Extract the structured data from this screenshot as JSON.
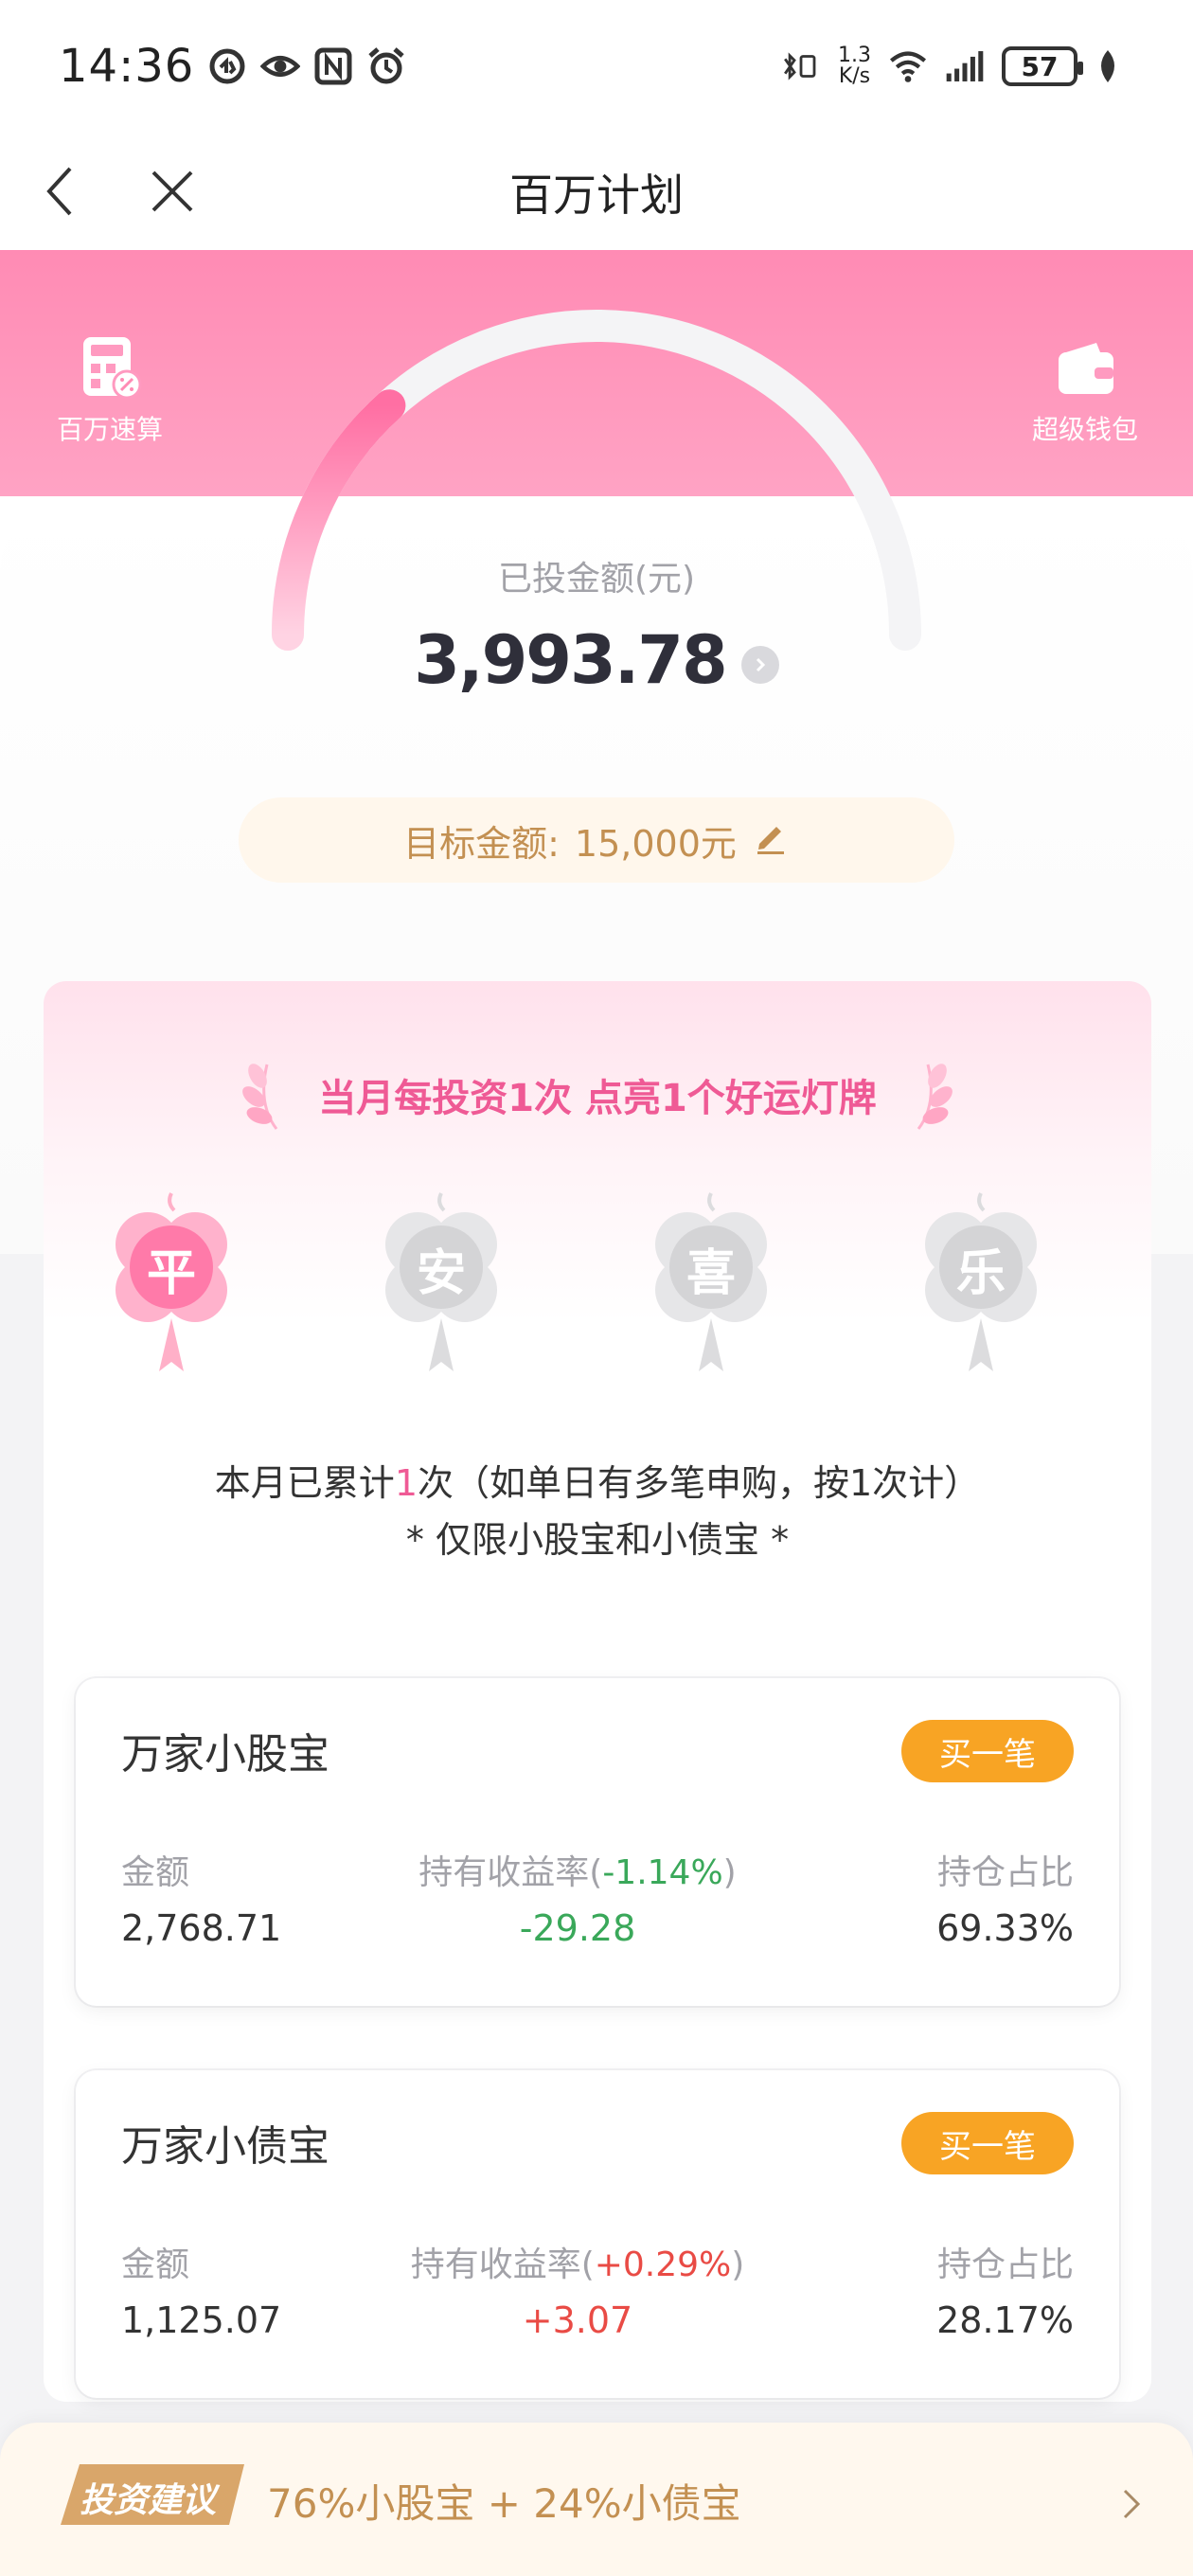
{
  "status_bar": {
    "time": "14:36",
    "net_speed_top": "1.3",
    "net_speed_bottom": "K/s",
    "battery": "57"
  },
  "nav": {
    "title": "百万计划"
  },
  "quick_actions": {
    "calc_label": "百万速算",
    "wallet_label": "超级钱包"
  },
  "summary": {
    "invested_label": "已投金额(元)",
    "invested_amount": "3,993.78",
    "target_label": "目标金额:",
    "target_amount": "15,000元",
    "progress": 0.266
  },
  "lucky": {
    "title": "当月每投资1次 点亮1个好运灯牌",
    "charms": [
      {
        "char": "平",
        "lit": true
      },
      {
        "char": "安",
        "lit": false
      },
      {
        "char": "喜",
        "lit": false
      },
      {
        "char": "乐",
        "lit": false
      }
    ],
    "note_prefix": "本月已累计",
    "note_count": "1",
    "note_suffix": "次（如单日有多笔申购，按1次计）",
    "note_line2": "* 仅限小股宝和小债宝 *"
  },
  "funds": [
    {
      "name": "万家小股宝",
      "buy_label": "买一笔",
      "amount_label": "金额",
      "amount": "2,768.71",
      "return_label": "持有收益率(",
      "return_rate": "-1.14%",
      "return_close": ")",
      "return_value": "-29.28",
      "share_label": "持仓占比",
      "share": "69.33%"
    },
    {
      "name": "万家小债宝",
      "buy_label": "买一笔",
      "amount_label": "金额",
      "amount": "1,125.07",
      "return_label": "持有收益率(",
      "return_rate": "+0.29%",
      "return_close": ")",
      "return_value": "+3.07",
      "share_label": "持仓占比",
      "share": "28.17%"
    }
  ],
  "advice": {
    "tag": "投资建议",
    "text": "76%小股宝 + 24%小债宝"
  },
  "colors": {
    "brand_pink": "#ff8bb4",
    "accent_pink": "#ef5a95",
    "buy_orange": "#f8a424",
    "gain_red": "#e94b45",
    "loss_green": "#3aa85a",
    "gold": "#c39052"
  }
}
